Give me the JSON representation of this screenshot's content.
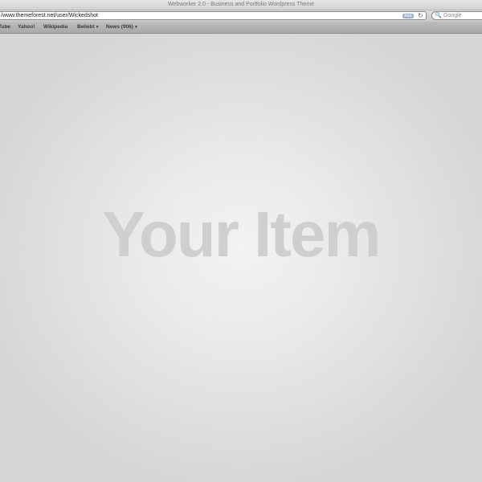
{
  "window": {
    "title": "Webworker 2.0 - Business and Portfolio Wordpress Theme"
  },
  "toolbar": {
    "url": "/www.themeforest.net/user/Wickedshot",
    "rss_label": "RSS",
    "search_placeholder": "Google"
  },
  "bookmarks": [
    {
      "label": "Tube"
    },
    {
      "label": "Yahoo!"
    },
    {
      "label": "Wikipedia"
    },
    {
      "label": "Beliebt"
    },
    {
      "label": "News (906)"
    }
  ],
  "content": {
    "hero_text": "Your Item"
  }
}
